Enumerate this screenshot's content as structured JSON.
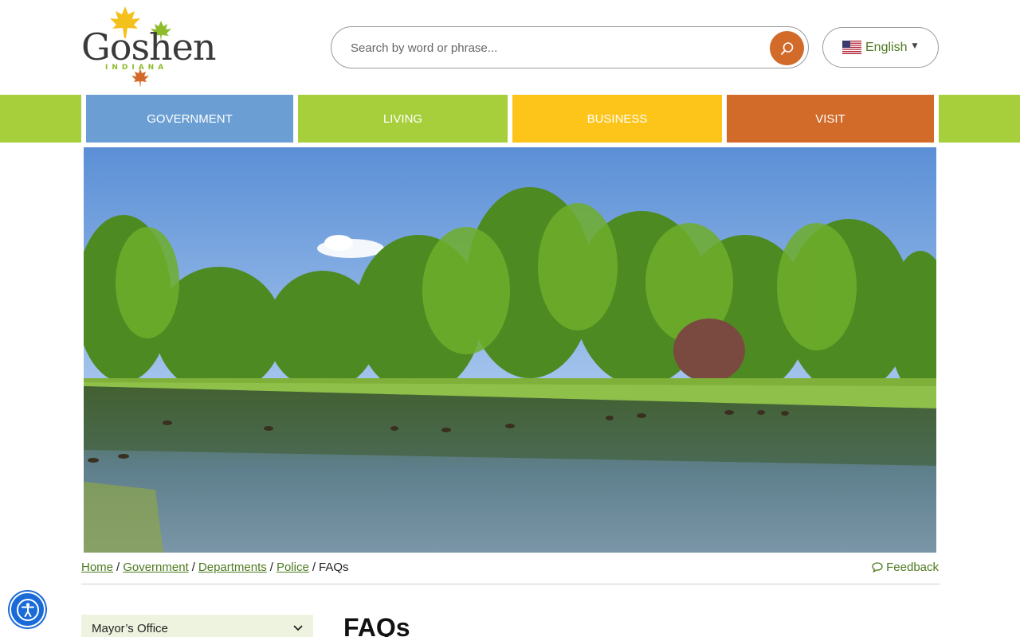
{
  "header": {
    "logo": {
      "title": "Goshen",
      "subtitle": "INDIANA"
    },
    "search": {
      "placeholder": "Search by word or phrase...",
      "button_icon": "search-icon"
    },
    "language": {
      "label": "English",
      "flag_icon": "us-flag-icon",
      "caret_icon": "caret-down-icon"
    }
  },
  "nav": {
    "items": [
      {
        "label": "Government",
        "color": "#6b9fd4"
      },
      {
        "label": "Living",
        "color": "#a6cf3b"
      },
      {
        "label": "Business",
        "color": "#fdc41a"
      },
      {
        "label": "Visit",
        "color": "#d26a2a"
      }
    ],
    "edge_color": "#a6cf3b"
  },
  "breadcrumb": {
    "links": [
      "Home",
      "Government",
      "Departments",
      "Police"
    ],
    "current": "FAQs"
  },
  "feedback": {
    "label": "Feedback",
    "icon": "speech-bubble-icon"
  },
  "sidebar": {
    "menu_label": "Mayor’s Office",
    "chevron_icon": "chevron-down-icon"
  },
  "main": {
    "title": "FAQs"
  },
  "accessibility": {
    "icon": "accessibility-icon"
  },
  "colors": {
    "link_green": "#4d7a1f",
    "accent_orange": "#d26a2a"
  }
}
